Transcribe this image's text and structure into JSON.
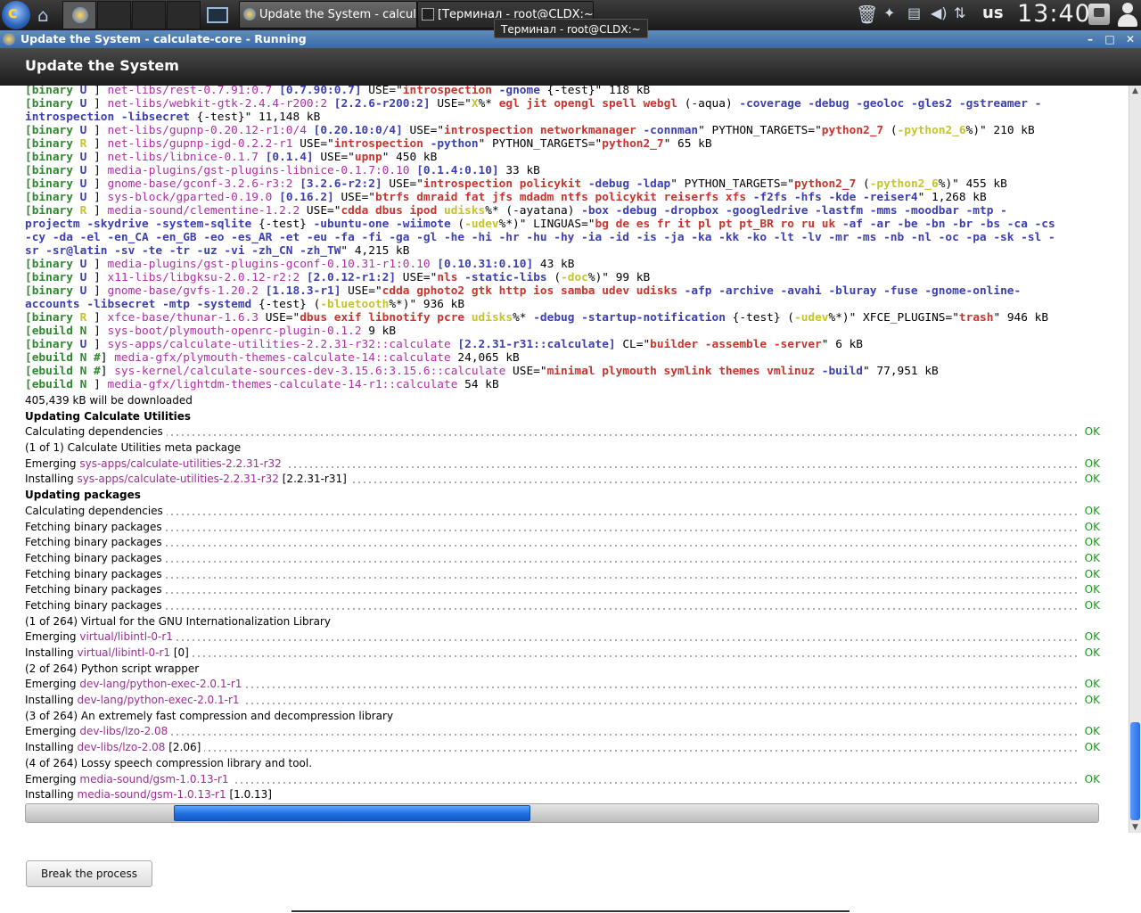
{
  "taskbar": {
    "tasks": [
      {
        "label": "Update the System - calculat..."
      },
      {
        "label": "[Терминал - root@CLDX:~]"
      }
    ],
    "keyboard_layout": "us",
    "clock": "13:40"
  },
  "tooltip": "Терминал - root@CLDX:~",
  "window": {
    "title": "Update the System - calculate-core - Running",
    "minimize": "–",
    "maximize": "□",
    "close": "✕"
  },
  "header": {
    "title": "Update the System"
  },
  "terminal_lines": [
    [
      [
        "[binary ",
        "g"
      ],
      [
        "U",
        "bl"
      ],
      [
        " ] ",
        ""
      ],
      [
        "net-libs/rest-0.7.91:0.7 ",
        "mg"
      ],
      [
        "[0.7.90:0.7]",
        "bl"
      ],
      [
        " USE=\"",
        ""
      ],
      [
        "introspection ",
        "rd"
      ],
      [
        "-gnome ",
        "bl"
      ],
      [
        "{-test}",
        ""
      ],
      [
        "\" 118 kB",
        ""
      ]
    ],
    [
      [
        "[binary ",
        "g"
      ],
      [
        "U",
        "bl"
      ],
      [
        " ] ",
        ""
      ],
      [
        "net-libs/webkit-gtk-2.4.4-r200:2 ",
        "mg"
      ],
      [
        "[2.2.6-r200:2]",
        "bl"
      ],
      [
        " USE=\"",
        ""
      ],
      [
        "X",
        "yl"
      ],
      [
        "%* ",
        ""
      ],
      [
        "egl jit opengl spell webgl ",
        "rd"
      ],
      [
        "(-aqua) ",
        ""
      ],
      [
        "-coverage -debug -geoloc -gles2 -gstreamer -",
        "bl"
      ]
    ],
    [
      [
        "introspection -libsecret ",
        "bl"
      ],
      [
        "{-test}",
        ""
      ],
      [
        "\" 11,148 kB",
        ""
      ]
    ],
    [
      [
        "[binary ",
        "g"
      ],
      [
        "U",
        "bl"
      ],
      [
        " ] ",
        ""
      ],
      [
        "net-libs/gupnp-0.20.12-r1:0/4 ",
        "mg"
      ],
      [
        "[0.20.10:0/4]",
        "bl"
      ],
      [
        " USE=\"",
        ""
      ],
      [
        "introspection networkmanager ",
        "rd"
      ],
      [
        "-connman",
        "bl"
      ],
      [
        "\" PYTHON_TARGETS=\"",
        ""
      ],
      [
        "python2_7 ",
        "rd"
      ],
      [
        "(",
        ""
      ],
      [
        "-python2_6",
        "yl"
      ],
      [
        "%)\" 210 kB",
        ""
      ]
    ],
    [
      [
        "[binary ",
        "g"
      ],
      [
        "R",
        "yl"
      ],
      [
        " ] ",
        ""
      ],
      [
        "net-libs/gupnp-igd-0.2.2-r1",
        "mg"
      ],
      [
        " USE=\"",
        ""
      ],
      [
        "introspection ",
        "rd"
      ],
      [
        "-python",
        "bl"
      ],
      [
        "\" PYTHON_TARGETS=\"",
        ""
      ],
      [
        "python2_7",
        "rd"
      ],
      [
        "\" 65 kB",
        ""
      ]
    ],
    [
      [
        "[binary ",
        "g"
      ],
      [
        "U",
        "bl"
      ],
      [
        " ] ",
        ""
      ],
      [
        "net-libs/libnice-0.1.7 ",
        "mg"
      ],
      [
        "[0.1.4]",
        "bl"
      ],
      [
        " USE=\"",
        ""
      ],
      [
        "upnp",
        "rd"
      ],
      [
        "\" 450 kB",
        ""
      ]
    ],
    [
      [
        "[binary ",
        "g"
      ],
      [
        "U",
        "bl"
      ],
      [
        " ] ",
        ""
      ],
      [
        "media-plugins/gst-plugins-libnice-0.1.7:0.10 ",
        "mg"
      ],
      [
        "[0.1.4:0.10]",
        "bl"
      ],
      [
        " 33 kB",
        ""
      ]
    ],
    [
      [
        "[binary ",
        "g"
      ],
      [
        "U",
        "bl"
      ],
      [
        " ] ",
        ""
      ],
      [
        "gnome-base/gconf-3.2.6-r3:2 ",
        "mg"
      ],
      [
        "[3.2.6-r2:2]",
        "bl"
      ],
      [
        " USE=\"",
        ""
      ],
      [
        "introspection policykit ",
        "rd"
      ],
      [
        "-debug -ldap",
        "bl"
      ],
      [
        "\" PYTHON_TARGETS=\"",
        ""
      ],
      [
        "python2_7 ",
        "rd"
      ],
      [
        "(",
        ""
      ],
      [
        "-python2_6",
        "yl"
      ],
      [
        "%)\" 455 kB",
        ""
      ]
    ],
    [
      [
        "[binary ",
        "g"
      ],
      [
        "U",
        "bl"
      ],
      [
        " ] ",
        ""
      ],
      [
        "sys-block/gparted-0.19.0 ",
        "mg"
      ],
      [
        "[0.16.2]",
        "bl"
      ],
      [
        " USE=\"",
        ""
      ],
      [
        "btrfs dmraid fat jfs mdadm ntfs policykit reiserfs xfs ",
        "rd"
      ],
      [
        "-f2fs -hfs -kde -reiser4",
        "bl"
      ],
      [
        "\" 1,268 kB",
        ""
      ]
    ],
    [
      [
        "[binary ",
        "g"
      ],
      [
        "R",
        "yl"
      ],
      [
        " ] ",
        ""
      ],
      [
        "media-sound/clementine-1.2.2",
        "mg"
      ],
      [
        " USE=\"",
        ""
      ],
      [
        "cdda dbus ipod ",
        "rd"
      ],
      [
        "udisks",
        "yl"
      ],
      [
        "%* (",
        ""
      ],
      [
        "-ayatana",
        ""
      ],
      [
        ") ",
        ""
      ],
      [
        "-box -debug -dropbox -googledrive -lastfm -mms -moodbar -mtp -",
        "bl"
      ]
    ],
    [
      [
        "projectm -skydrive -system-sqlite ",
        "bl"
      ],
      [
        "{-test} ",
        ""
      ],
      [
        "-ubuntu-one -wiimote ",
        "bl"
      ],
      [
        "(",
        ""
      ],
      [
        "-udev",
        "yl"
      ],
      [
        "%*)\" LINGUAS=\"",
        ""
      ],
      [
        "bg de es fr it pl pt pt_BR ro ru uk ",
        "rd"
      ],
      [
        "-af -ar -be -bn -br -bs -ca -cs",
        "bl"
      ]
    ],
    [
      [
        "-cy -da -el -en_CA -en_GB -eo -es_AR -et -eu -fa -fi -ga -gl -he -hi -hr -hu -hy -ia -id -is -ja -ka -kk -ko -lt -lv -mr -ms -nb -nl -oc -pa -sk -sl -",
        "bl"
      ]
    ],
    [
      [
        "sr -sr@latin -sv -te -tr -uz -vi -zh_CN -zh_TW",
        "bl"
      ],
      [
        "\" 4,215 kB",
        ""
      ]
    ],
    [
      [
        "[binary ",
        "g"
      ],
      [
        "U",
        "bl"
      ],
      [
        " ] ",
        ""
      ],
      [
        "media-plugins/gst-plugins-gconf-0.10.31-r1:0.10 ",
        "mg"
      ],
      [
        "[0.10.31:0.10]",
        "bl"
      ],
      [
        " 43 kB",
        ""
      ]
    ],
    [
      [
        "[binary ",
        "g"
      ],
      [
        "U",
        "bl"
      ],
      [
        " ] ",
        ""
      ],
      [
        "x11-libs/libgksu-2.0.12-r2:2 ",
        "mg"
      ],
      [
        "[2.0.12-r1:2]",
        "bl"
      ],
      [
        " USE=\"",
        ""
      ],
      [
        "nls ",
        "rd"
      ],
      [
        "-static-libs ",
        "bl"
      ],
      [
        "(",
        ""
      ],
      [
        "-doc",
        "yl"
      ],
      [
        "%)\" 99 kB",
        ""
      ]
    ],
    [
      [
        "[binary ",
        "g"
      ],
      [
        "U",
        "bl"
      ],
      [
        " ] ",
        ""
      ],
      [
        "gnome-base/gvfs-1.20.2 ",
        "mg"
      ],
      [
        "[1.18.3-r1]",
        "bl"
      ],
      [
        " USE=\"",
        ""
      ],
      [
        "cdda gphoto2 gtk http ios samba udev udisks ",
        "rd"
      ],
      [
        "-afp -archive -avahi -bluray -fuse -gnome-online-",
        "bl"
      ]
    ],
    [
      [
        "accounts -libsecret -mtp -systemd ",
        "bl"
      ],
      [
        "{-test} (",
        ""
      ],
      [
        "-bluetooth",
        "yl"
      ],
      [
        "%*)\" 936 kB",
        ""
      ]
    ],
    [
      [
        "[binary ",
        "g"
      ],
      [
        "R",
        "yl"
      ],
      [
        " ] ",
        ""
      ],
      [
        "xfce-base/thunar-1.6.3",
        "mg"
      ],
      [
        " USE=\"",
        ""
      ],
      [
        "dbus exif libnotify pcre ",
        "rd"
      ],
      [
        "udisks",
        "yl"
      ],
      [
        "%* ",
        ""
      ],
      [
        "-debug -startup-notification ",
        "bl"
      ],
      [
        "{-test} (",
        ""
      ],
      [
        "-udev",
        "yl"
      ],
      [
        "%*)\" XFCE_PLUGINS=\"",
        ""
      ],
      [
        "trash",
        "rd"
      ],
      [
        "\" 946 kB",
        ""
      ]
    ],
    [
      [
        "[ebuild ",
        "g"
      ],
      [
        "N",
        "g"
      ],
      [
        " ] ",
        ""
      ],
      [
        "sys-boot/plymouth-openrc-plugin-0.1.2",
        "mg"
      ],
      [
        " 9 kB",
        ""
      ]
    ],
    [
      [
        "[binary ",
        "g"
      ],
      [
        "U",
        "bl"
      ],
      [
        " ] ",
        ""
      ],
      [
        "sys-apps/calculate-utilities-2.2.31-r32::calculate ",
        "mg"
      ],
      [
        "[2.2.31-r31::calculate]",
        "bl"
      ],
      [
        " CL=\"",
        ""
      ],
      [
        "builder -assemble -server",
        "rd"
      ],
      [
        "\" 6 kB",
        ""
      ]
    ],
    [
      [
        "[ebuild ",
        "g"
      ],
      [
        "N #",
        "g"
      ],
      [
        "] ",
        ""
      ],
      [
        "media-gfx/plymouth-themes-calculate-14::calculate",
        "mg"
      ],
      [
        " 24,065 kB",
        ""
      ]
    ],
    [
      [
        "[ebuild ",
        "g"
      ],
      [
        "N #",
        "g"
      ],
      [
        "] ",
        ""
      ],
      [
        "sys-kernel/calculate-sources-dev-3.15.6:3.15.6::calculate",
        "mg"
      ],
      [
        " USE=\"",
        ""
      ],
      [
        "minimal plymouth symlink themes vmlinuz ",
        "rd"
      ],
      [
        "-build",
        "bl"
      ],
      [
        "\" 77,951 kB",
        ""
      ]
    ],
    [
      [
        "[ebuild ",
        "g"
      ],
      [
        "N",
        "g"
      ],
      [
        " ] ",
        ""
      ],
      [
        "media-gfx/lightdm-themes-calculate-14-r1::calculate",
        "mg"
      ],
      [
        " 54 kB",
        ""
      ]
    ]
  ],
  "status_lines": [
    {
      "text": "405,439 kB will be downloaded",
      "pkg": "",
      "suffix": "",
      "status": "",
      "header": false
    },
    {
      "text": "Updating Calculate Utilities",
      "pkg": "",
      "suffix": "",
      "status": "",
      "header": true
    },
    {
      "text": "Calculating dependencies",
      "pkg": "",
      "suffix": "",
      "status": "OK",
      "header": false
    },
    {
      "text": "(1 of 1) Calculate Utilities meta package",
      "pkg": "",
      "suffix": "",
      "status": "",
      "header": false
    },
    {
      "text": "Emerging ",
      "pkg": "sys-apps/calculate-utilities-2.2.31-r32",
      "suffix": "",
      "status": "OK",
      "header": false
    },
    {
      "text": "Installing ",
      "pkg": "sys-apps/calculate-utilities-2.2.31-r32",
      "suffix": " [2.2.31-r31]",
      "status": "OK",
      "header": false
    },
    {
      "text": "Updating packages",
      "pkg": "",
      "suffix": "",
      "status": "",
      "header": true
    },
    {
      "text": "Calculating dependencies",
      "pkg": "",
      "suffix": "",
      "status": "OK",
      "header": false
    },
    {
      "text": "Fetching binary packages",
      "pkg": "",
      "suffix": "",
      "status": "OK",
      "header": false
    },
    {
      "text": "Fetching binary packages",
      "pkg": "",
      "suffix": "",
      "status": "OK",
      "header": false
    },
    {
      "text": "Fetching binary packages",
      "pkg": "",
      "suffix": "",
      "status": "OK",
      "header": false
    },
    {
      "text": "Fetching binary packages",
      "pkg": "",
      "suffix": "",
      "status": "OK",
      "header": false
    },
    {
      "text": "Fetching binary packages",
      "pkg": "",
      "suffix": "",
      "status": "OK",
      "header": false
    },
    {
      "text": "Fetching binary packages",
      "pkg": "",
      "suffix": "",
      "status": "OK",
      "header": false
    },
    {
      "text": "(1 of 264) Virtual for the GNU Internationalization Library",
      "pkg": "",
      "suffix": "",
      "status": "",
      "header": false
    },
    {
      "text": "Emerging ",
      "pkg": "virtual/libintl-0-r1",
      "suffix": "",
      "status": "OK",
      "header": false
    },
    {
      "text": "Installing ",
      "pkg": "virtual/libintl-0-r1",
      "suffix": " [0]",
      "status": "OK",
      "header": false
    },
    {
      "text": "(2 of 264) Python script wrapper",
      "pkg": "",
      "suffix": "",
      "status": "",
      "header": false
    },
    {
      "text": "Emerging ",
      "pkg": "dev-lang/python-exec-2.0.1-r1",
      "suffix": "",
      "status": "OK",
      "header": false
    },
    {
      "text": "Installing ",
      "pkg": "dev-lang/python-exec-2.0.1-r1",
      "suffix": "",
      "status": "OK",
      "header": false
    },
    {
      "text": "(3 of 264) An extremely fast compression and decompression library",
      "pkg": "",
      "suffix": "",
      "status": "",
      "header": false
    },
    {
      "text": "Emerging ",
      "pkg": "dev-libs/lzo-2.08",
      "suffix": "",
      "status": "OK",
      "header": false
    },
    {
      "text": "Installing ",
      "pkg": "dev-libs/lzo-2.08",
      "suffix": " [2.06]",
      "status": "OK",
      "header": false
    },
    {
      "text": "(4 of 264) Lossy speech compression library and tool.",
      "pkg": "",
      "suffix": "",
      "status": "",
      "header": false
    },
    {
      "text": "Emerging ",
      "pkg": "media-sound/gsm-1.0.13-r1",
      "suffix": "",
      "status": "OK",
      "header": false
    },
    {
      "text": "Installing ",
      "pkg": "media-sound/gsm-1.0.13-r1",
      "suffix": " [1.0.13]",
      "status": "",
      "header": false
    }
  ],
  "progress": {
    "state": "indeterminate",
    "colors": {
      "fill": "#2a73e6",
      "track": "#cccccc"
    }
  },
  "buttons": {
    "break": "Break the process"
  },
  "colors": {
    "ok": "#1a9a1a",
    "package": "#9b2f93",
    "header_bg": "#2e2e2e",
    "titlebar": "#4a78b0"
  }
}
